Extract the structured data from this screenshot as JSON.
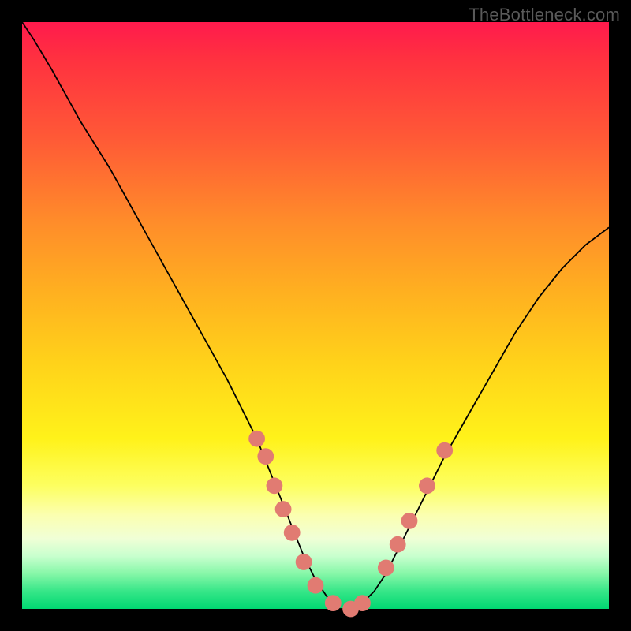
{
  "watermark": "TheBottleneck.com",
  "chart_data": {
    "type": "line",
    "title": "",
    "xlabel": "",
    "ylabel": "",
    "xlim": [
      0,
      100
    ],
    "ylim": [
      0,
      100
    ],
    "grid": false,
    "background_gradient": {
      "top": "#ff1a4d",
      "bottom": "#00d872"
    },
    "series": [
      {
        "name": "bottleneck-curve",
        "x": [
          0,
          2,
          5,
          10,
          15,
          20,
          25,
          30,
          35,
          40,
          42,
          44,
          46,
          48,
          50,
          52,
          54,
          56,
          58,
          60,
          62,
          64,
          68,
          72,
          76,
          80,
          84,
          88,
          92,
          96,
          100
        ],
        "y": [
          100,
          97,
          92,
          83,
          75,
          66,
          57,
          48,
          39,
          29,
          24,
          19,
          14,
          9,
          5,
          2,
          0,
          0,
          1,
          3,
          6,
          10,
          18,
          26,
          33,
          40,
          47,
          53,
          58,
          62,
          65
        ]
      }
    ],
    "markers": [
      {
        "x": 40,
        "y": 29
      },
      {
        "x": 41.5,
        "y": 26
      },
      {
        "x": 43,
        "y": 21
      },
      {
        "x": 44.5,
        "y": 17
      },
      {
        "x": 46,
        "y": 13
      },
      {
        "x": 48,
        "y": 8
      },
      {
        "x": 50,
        "y": 4
      },
      {
        "x": 53,
        "y": 1
      },
      {
        "x": 56,
        "y": 0
      },
      {
        "x": 58,
        "y": 1
      },
      {
        "x": 62,
        "y": 7
      },
      {
        "x": 64,
        "y": 11
      },
      {
        "x": 66,
        "y": 15
      },
      {
        "x": 69,
        "y": 21
      },
      {
        "x": 72,
        "y": 27
      }
    ],
    "marker_color": "#e17b72",
    "marker_radius_approx_pct": 1.4
  }
}
